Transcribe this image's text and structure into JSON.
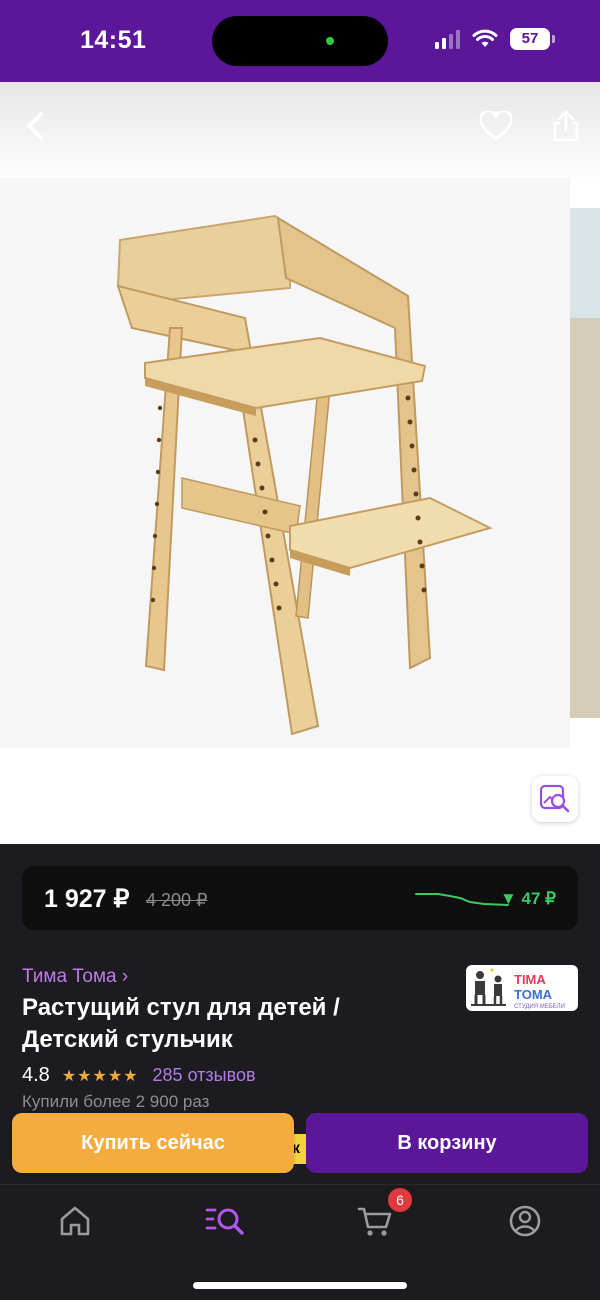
{
  "status_bar": {
    "time": "14:51",
    "battery": "57"
  },
  "product": {
    "price_current": "1 927 ₽",
    "price_old": "4 200 ₽",
    "price_drop": "▼ 47 ₽",
    "brand": "Тима Тома ›",
    "title": "Растущий стул для детей / Детский стульчик",
    "rating": "4.8",
    "stars": "★★★★★",
    "reviews": "285 отзывов",
    "bought": "Купили более 2 900 раз",
    "shop_logo": {
      "line1a": "TIMA",
      "line1b": "TOMA",
      "line2": "СТУДИЯ МЕБЕЛИ"
    }
  },
  "actions": {
    "buy_now": "Купить сейчас",
    "add_to_cart": "В корзину",
    "peek_badge": "к"
  },
  "tab_bar": {
    "cart_count": "6"
  },
  "colors": {
    "brand_purple": "#5b1699",
    "buy_orange": "#f4ac3f",
    "price_green": "#3cc964",
    "link_purple": "#c07be8"
  },
  "icons": [
    "back-icon",
    "heart-icon",
    "share-icon",
    "visual-search-icon",
    "home-icon",
    "catalog-search-icon",
    "cart-icon",
    "profile-icon"
  ]
}
